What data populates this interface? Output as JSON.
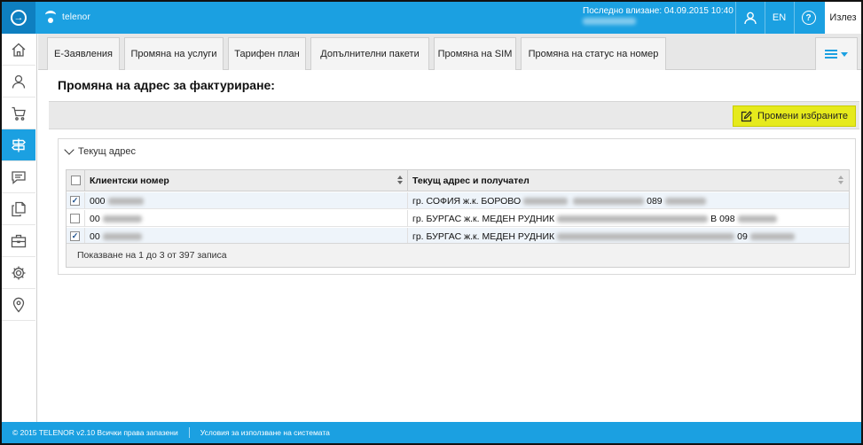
{
  "colors": {
    "brand": "#1ba0e1",
    "accent_button": "#e6ea1c"
  },
  "header": {
    "brand_name": "telenor",
    "last_login": "Последно влизане: 04.09.2015 10:40",
    "language": "EN",
    "logout_label": "Излез"
  },
  "sidebar": {
    "items": [
      {
        "icon": "home-icon"
      },
      {
        "icon": "user-icon"
      },
      {
        "icon": "cart-icon"
      },
      {
        "icon": "signpost-icon",
        "active": true
      },
      {
        "icon": "chat-icon"
      },
      {
        "icon": "documents-icon"
      },
      {
        "icon": "briefcase-icon"
      },
      {
        "icon": "gear-icon"
      },
      {
        "icon": "location-pin-icon"
      }
    ]
  },
  "tabs": [
    {
      "label": "E-Заявления"
    },
    {
      "label": "Промяна на услуги"
    },
    {
      "label": "Тарифен план"
    },
    {
      "label": "Допълнителни пакети"
    },
    {
      "label": "Промяна на SIM"
    },
    {
      "label": "Промяна на статус на номер"
    }
  ],
  "page_title": "Промяна на адрес за фактуриране:",
  "edit_button_label": "Промени избраните",
  "panel": {
    "title": "Текущ адрес",
    "columns": [
      "Клиентски номер",
      "Текущ адрес и получател"
    ],
    "rows": [
      {
        "checked": true,
        "client_prefix": "000",
        "address": "гр. СОФИЯ ж.к. БОРОВО",
        "phone_prefix": "089"
      },
      {
        "checked": false,
        "client_prefix": "00",
        "address": "гр. БУРГАС ж.к. МЕДЕН РУДНИК",
        "phone_prefix": "В 098"
      },
      {
        "checked": true,
        "client_prefix": "00",
        "address": "гр. БУРГАС ж.к. МЕДЕН РУДНИК",
        "phone_prefix": "09"
      }
    ],
    "footer": "Показване на 1 до 3 от 397 записа"
  },
  "footer": {
    "copyright": "© 2015 TELENOR v2.10 Всички права запазени",
    "terms_link": "Условия за използване на системата"
  }
}
